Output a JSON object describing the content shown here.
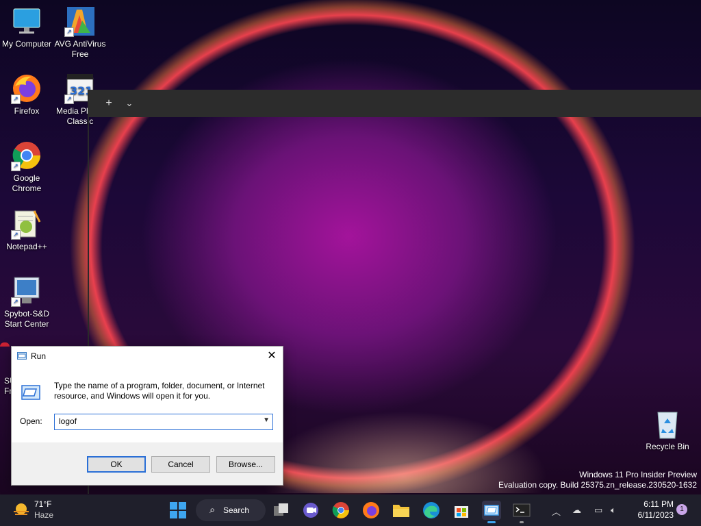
{
  "desktop": {
    "icons": [
      {
        "label": "My Computer",
        "icon": "monitor-icon"
      },
      {
        "label": "AVG AntiVirus Free",
        "icon": "avg-icon"
      },
      {
        "label": "Firefox",
        "icon": "firefox-icon"
      },
      {
        "label": "Media Player Classic",
        "icon": "media-player-icon"
      },
      {
        "label": "Google Chrome",
        "icon": "chrome-icon"
      },
      {
        "label": "Notepad++",
        "icon": "notepad-plus-icon"
      },
      {
        "label": "Spybot-S&D Start Center",
        "icon": "spybot-icon"
      },
      {
        "label": "Recycle Bin",
        "icon": "recycle-bin-icon"
      }
    ],
    "partial_label": "SU Fr",
    "watermark_line1": "Windows 11 Pro Insider Preview",
    "watermark_line2": "Evaluation copy. Build 25375.zn_release.230520-1632"
  },
  "terminal": {
    "new_tab": "+",
    "dropdown": "⌄"
  },
  "run_dialog": {
    "title": "Run",
    "description": "Type the name of a program, folder, document, or Internet resource, and Windows will open it for you.",
    "open_label": "Open:",
    "open_value": "logof",
    "ok": "OK",
    "cancel": "Cancel",
    "browse": "Browse..."
  },
  "taskbar": {
    "weather_temp": "71°F",
    "weather_desc": "Haze",
    "search_label": "Search",
    "time": "6:11 PM",
    "date": "6/11/2023",
    "notification_count": "1"
  },
  "colors": {
    "accent": "#2a6fd6",
    "taskbar": "#1f1f2b"
  }
}
